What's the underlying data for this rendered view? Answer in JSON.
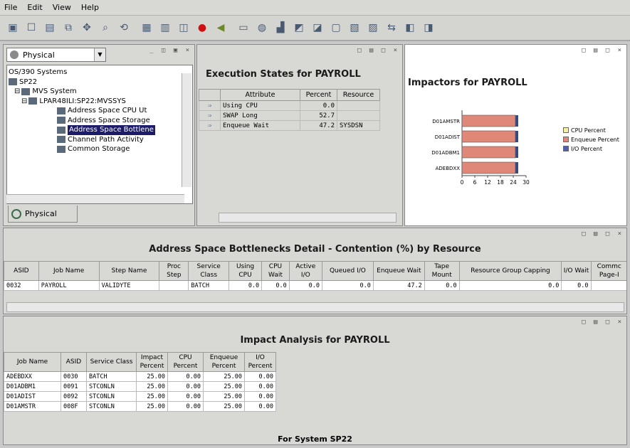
{
  "menu": [
    "File",
    "Edit",
    "View",
    "Help"
  ],
  "toolbar": {
    "icons": [
      "save-icon",
      "properties-icon",
      "print-icon",
      "copy-icon",
      "move-icon",
      "find-icon",
      "refresh-icon",
      "grid-icon",
      "table-icon",
      "chart-icon",
      "stop-icon",
      "sound-icon",
      "layout-icon",
      "globe-icon",
      "bar-chart-icon",
      "plot-icon",
      "workspace-icon",
      "window-icon",
      "report-icon",
      "view-icon",
      "link-icon",
      "situation-icon",
      "terminal-icon"
    ]
  },
  "tree": {
    "view": "Physical",
    "items": [
      {
        "label": "OS/390 Systems",
        "level": 0
      },
      {
        "label": "SP22",
        "level": 0
      },
      {
        "label": "MVS System",
        "level": 1
      },
      {
        "label": "LPAR48ILI:SP22:MVSSYS",
        "level": 2
      },
      {
        "label": "Address Space CPU Ut",
        "level": 3
      },
      {
        "label": "Address Space Storage",
        "level": 3
      },
      {
        "label": "Address Space Bottlene",
        "level": 3,
        "selected": true
      },
      {
        "label": "Channel Path Activity",
        "level": 3
      },
      {
        "label": "Common Storage",
        "level": 3
      }
    ],
    "tab": "Physical"
  },
  "exec": {
    "title": "Execution States for PAYROLL",
    "headers": [
      "Attribute",
      "Percent",
      "Resource"
    ],
    "rows": [
      [
        "Using CPU",
        "0.0",
        ""
      ],
      [
        "SWAP Long",
        "52.7",
        ""
      ],
      [
        "Enqueue Wait",
        "47.2",
        "SYSDSN"
      ]
    ]
  },
  "impactors": {
    "title": "Impactors for PAYROLL",
    "legend": [
      {
        "label": "CPU Percent",
        "color": "#f5f0a0"
      },
      {
        "label": "Enqueue Percent",
        "color": "#e08878"
      },
      {
        "label": "I/O Percent",
        "color": "#5060b0"
      }
    ],
    "chart_data": {
      "type": "bar",
      "orientation": "horizontal",
      "stacked": true,
      "categories": [
        "D01AMSTR",
        "D01ADIST",
        "D01ADBM1",
        "ADEBDXX"
      ],
      "series": [
        {
          "name": "CPU Percent",
          "values": [
            0,
            0,
            0,
            0
          ]
        },
        {
          "name": "Enqueue Percent",
          "values": [
            25,
            25,
            25,
            25
          ]
        },
        {
          "name": "I/O Percent",
          "values": [
            0,
            0,
            0,
            0
          ]
        }
      ],
      "xlim": [
        0,
        30
      ],
      "xticks": [
        "0",
        "6",
        "12",
        "18",
        "24",
        "30"
      ],
      "legend_position": "right"
    }
  },
  "bottleneck": {
    "title": "Address Space Bottlenecks Detail - Contention (%) by Resource",
    "headers": [
      "ASID",
      "Job Name",
      "Step Name",
      "Proc Step",
      "Service Class",
      "Using CPU",
      "CPU Wait",
      "Active I/O",
      "Queued I/O",
      "Enqueue Wait",
      "Tape Mount",
      "Resource Group Capping",
      "I/O Wait",
      "Commc Page-I"
    ],
    "rows": [
      [
        "0032",
        "PAYROLL",
        "VALIDYTE",
        "",
        "BATCH",
        "0.0",
        "0.0",
        "0.0",
        "0.0",
        "47.2",
        "0.0",
        "0.0",
        "0.0",
        ""
      ]
    ]
  },
  "impact": {
    "title": "Impact Analysis for PAYROLL",
    "headers": [
      "Job Name",
      "ASID",
      "Service Class",
      "Impact Percent",
      "CPU Percent",
      "Enqueue Percent",
      "I/O Percent"
    ],
    "rows": [
      [
        "ADEBDXX",
        "0030",
        "BATCH",
        "25.00",
        "0.00",
        "25.00",
        "0.00"
      ],
      [
        "D01ADBM1",
        "0091",
        "STCONLN",
        "25.00",
        "0.00",
        "25.00",
        "0.00"
      ],
      [
        "D01ADIST",
        "0092",
        "STCONLN",
        "25.00",
        "0.00",
        "25.00",
        "0.00"
      ],
      [
        "D01AMSTR",
        "008F",
        "STCONLN",
        "25.00",
        "0.00",
        "25.00",
        "0.00"
      ]
    ],
    "footer": "For System SP22"
  },
  "panel_controls": "□ ▤ □ ×"
}
